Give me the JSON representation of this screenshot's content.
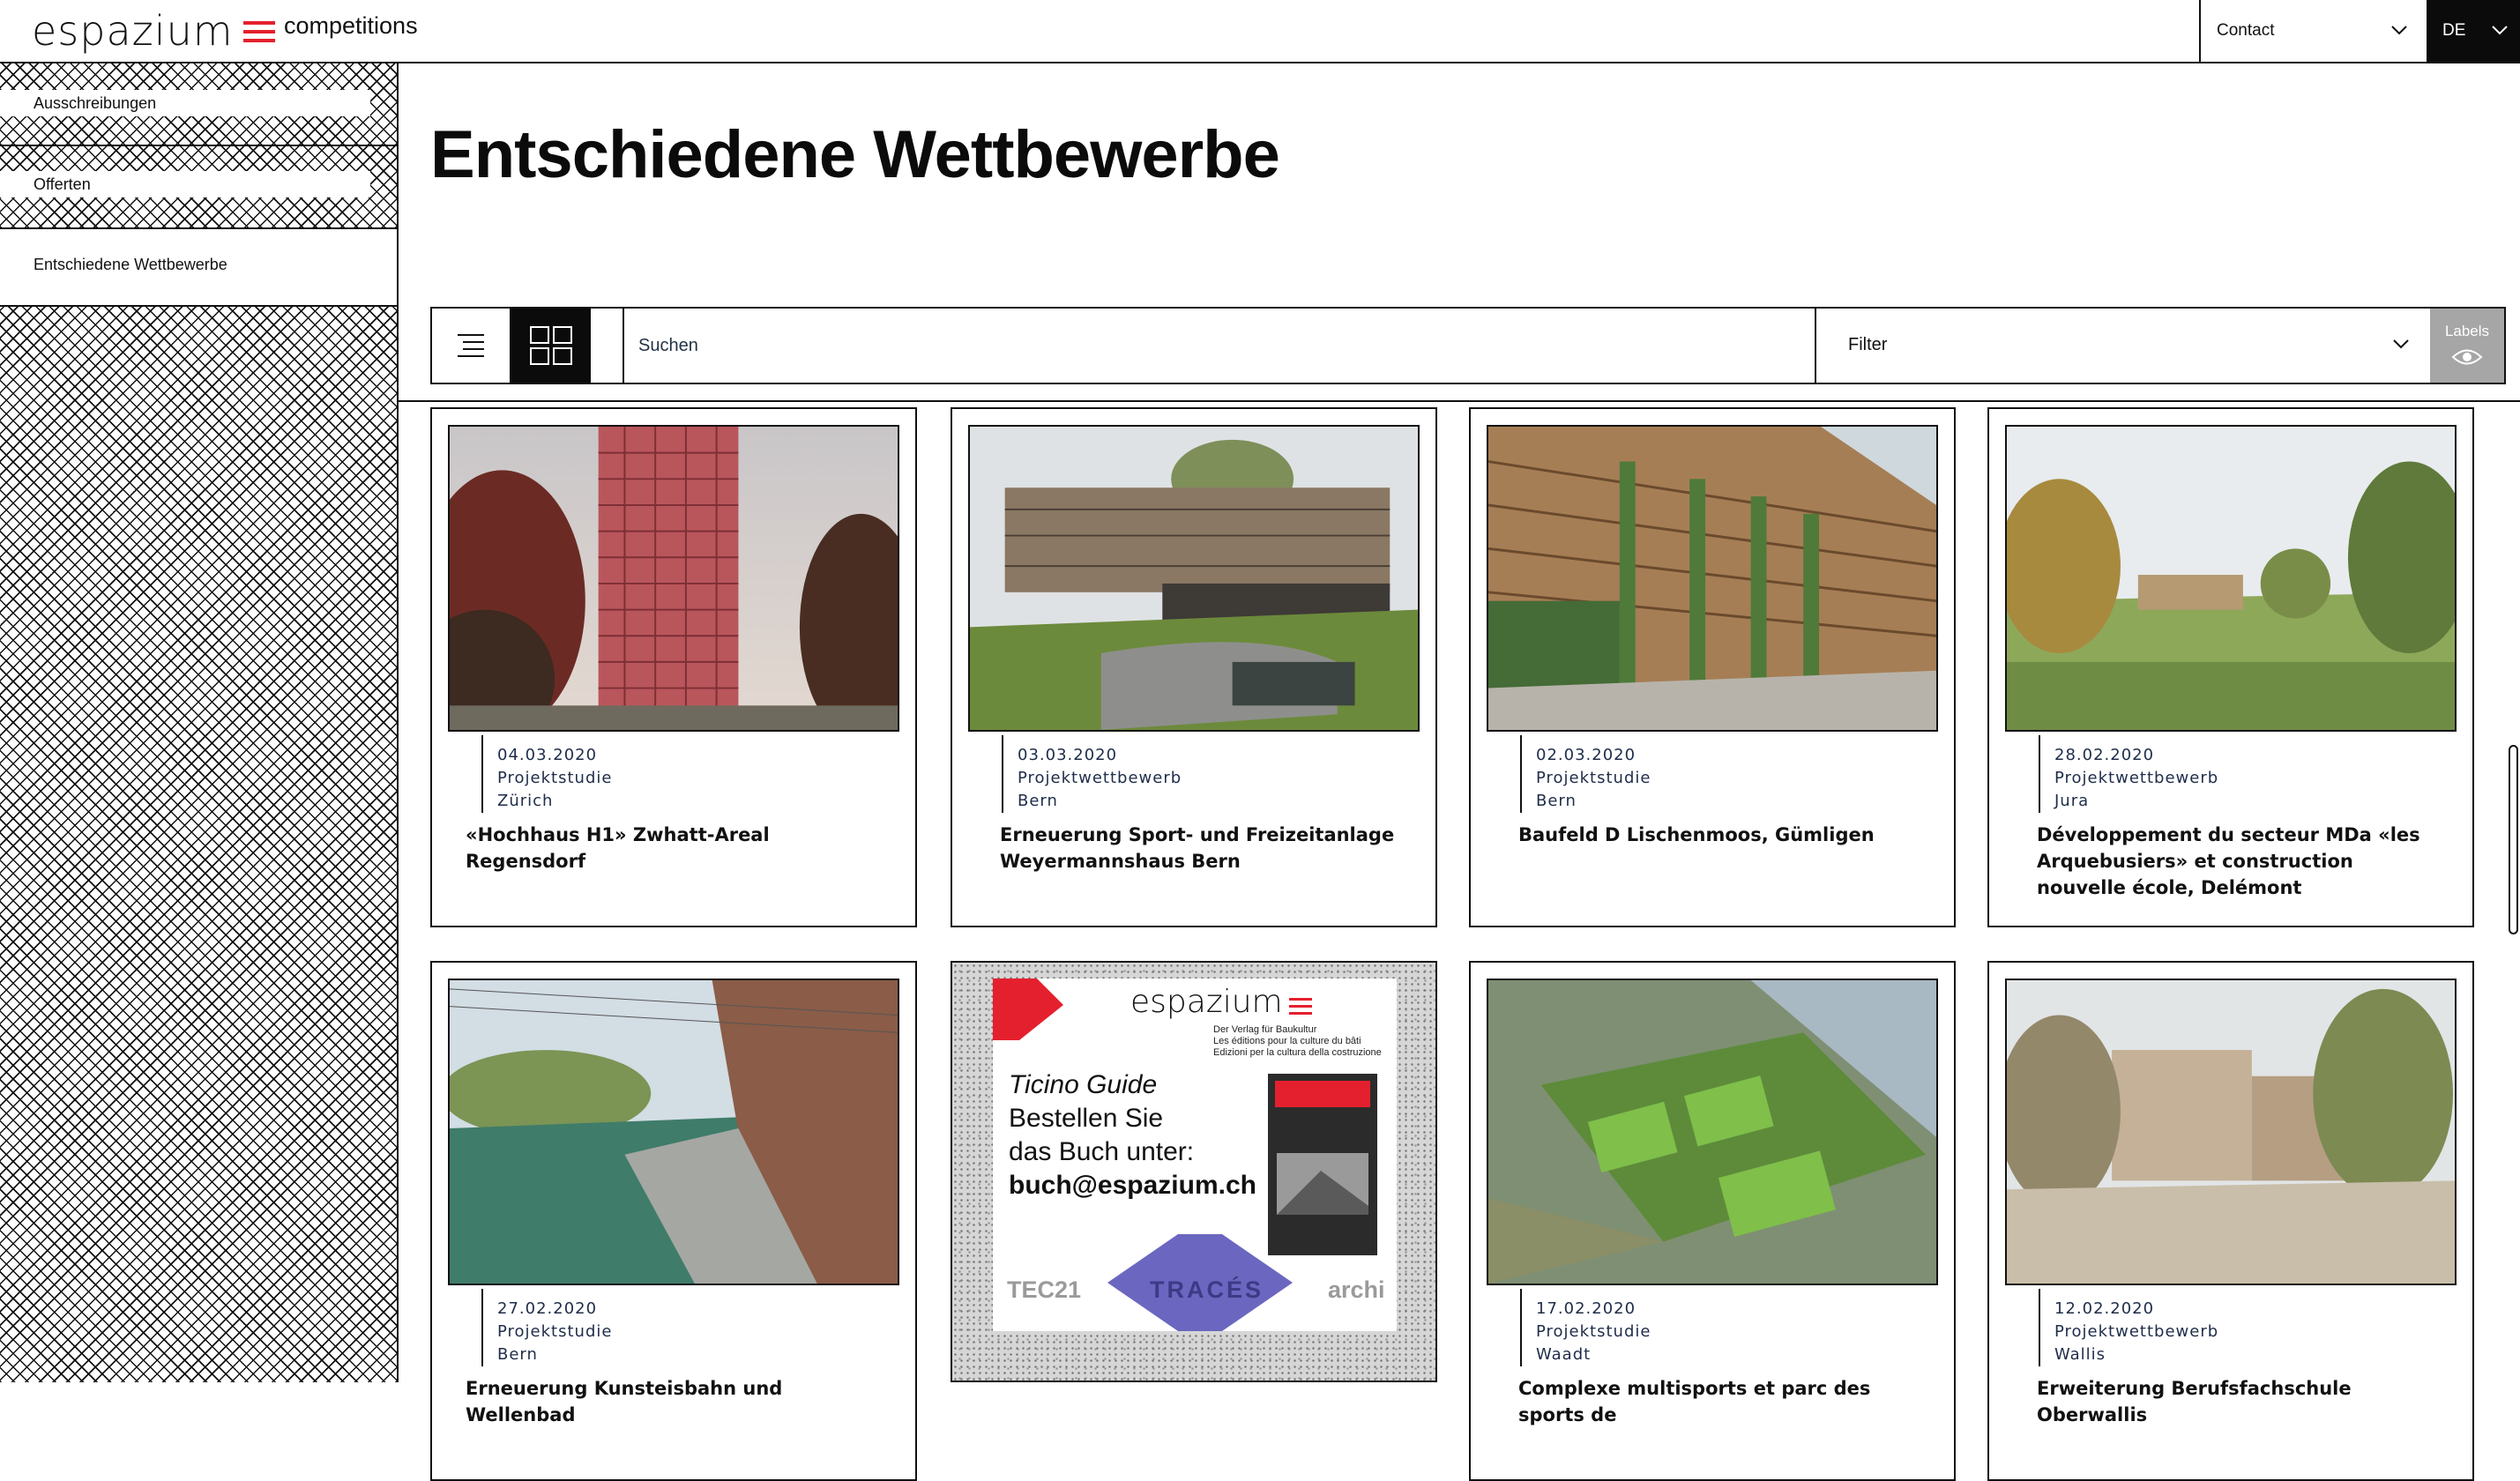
{
  "header": {
    "logo_text": "espazium",
    "logo_suffix": "competitions",
    "contact_label": "Contact",
    "lang_label": "DE",
    "accent_color": "#e5202e"
  },
  "sidebar": {
    "items": [
      {
        "label": "Ausschreibungen"
      },
      {
        "label": "Offerten"
      },
      {
        "label": "Entschiedene Wettbewerbe"
      }
    ]
  },
  "page": {
    "title": "Entschiedene Wettbewerbe"
  },
  "toolbar": {
    "list_view_icon": "list-icon",
    "grid_view_icon": "grid-icon",
    "search_placeholder": "Suchen",
    "filter_label": "Filter",
    "labels_label": "Labels",
    "labels_icon": "eye-icon"
  },
  "cards": [
    {
      "date": "04.03.2020",
      "type": "Projektstudie",
      "place": "Zürich",
      "title": "«Hochhaus H1» Zwhatt-Areal Regensdorf"
    },
    {
      "date": "03.03.2020",
      "type": "Projektwettbewerb",
      "place": "Bern",
      "title": "Erneuerung Sport- und Freizeitanlage Weyermannshaus Bern"
    },
    {
      "date": "02.03.2020",
      "type": "Projektstudie",
      "place": "Bern",
      "title": "Baufeld D Lischenmoos, Gümligen"
    },
    {
      "date": "28.02.2020",
      "type": "Projektwettbewerb",
      "place": "Jura",
      "title": "Développement du secteur MDa «les Arquebusiers» et construction nouvelle école, Delémont"
    },
    {
      "date": "27.02.2020",
      "type": "Projektstudie",
      "place": "Bern",
      "title": "Erneuerung Kunsteisbahn und Wellenbad"
    },
    {
      "date": "17.02.2020",
      "type": "Projektstudie",
      "place": "Waadt",
      "title": "Complexe multisports et parc des sports de"
    },
    {
      "date": "12.02.2020",
      "type": "Projektwettbewerb",
      "place": "Wallis",
      "title": "Erweiterung Berufsfachschule Oberwallis"
    }
  ],
  "ad": {
    "brand": "espazium",
    "tagline_1": "Der Verlag für Baukultur",
    "tagline_2": "Les éditions pour la culture du bâti",
    "tagline_3": "Edizioni per la cultura della costruzione",
    "line_1": "Ticino Guide",
    "line_2": "Bestellen Sie",
    "line_3": "das Buch unter:",
    "line_4": "buch@espazium.ch",
    "foot_1": "TEC21",
    "foot_2": "TRACÉS",
    "foot_3": "archi"
  }
}
